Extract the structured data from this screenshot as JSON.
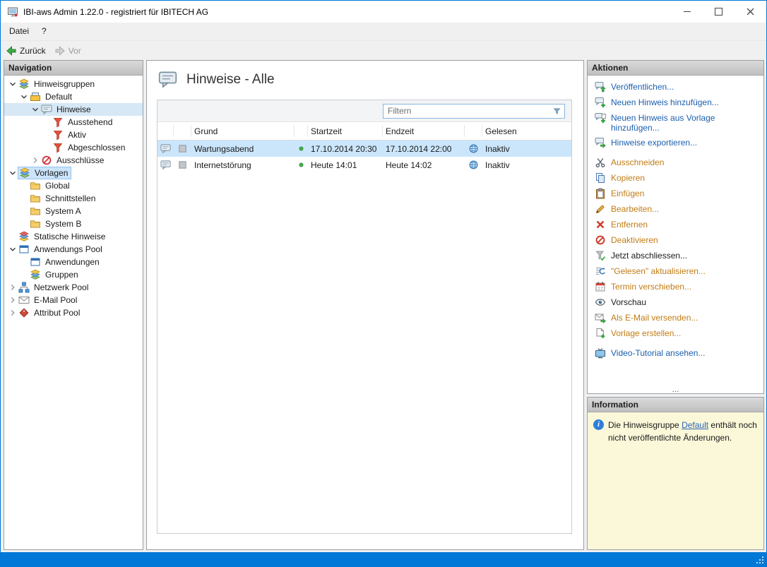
{
  "palette": {
    "accent_blue": "#0078D7",
    "link_blue": "#1B5FAE",
    "link_amber": "#C17C15",
    "text_dark": "#1B1B1B",
    "selection_blue": "#CBE6FB",
    "info_yellow": "#FBF8D9",
    "status_green": "#43B049",
    "alert_red": "#D13438"
  },
  "window": {
    "title": "IBI-aws Admin 1.22.0 - registriert für IBITECH AG"
  },
  "menu": {
    "items": [
      {
        "label": "Datei"
      },
      {
        "label": "?"
      }
    ]
  },
  "toolbar": {
    "back": "Zurück",
    "forward": "Vor"
  },
  "navigation": {
    "header": "Navigation",
    "items": [
      {
        "label": "Hinweisgruppen",
        "level": 0,
        "state": "expanded",
        "icon": "layers"
      },
      {
        "label": "Default",
        "level": 1,
        "state": "expanded",
        "icon": "group-box"
      },
      {
        "label": "Hinweise",
        "level": 2,
        "state": "expanded",
        "icon": "speech-bubble",
        "selected": true
      },
      {
        "label": "Ausstehend",
        "level": 3,
        "state": "leaf",
        "icon": "funnel"
      },
      {
        "label": "Aktiv",
        "level": 3,
        "state": "leaf",
        "icon": "funnel"
      },
      {
        "label": "Abgeschlossen",
        "level": 3,
        "state": "leaf",
        "icon": "funnel"
      },
      {
        "label": "Ausschlüsse",
        "level": 2,
        "state": "collapsed",
        "icon": "no-entry"
      },
      {
        "label": "Vorlagen",
        "level": 0,
        "state": "expanded",
        "icon": "layers",
        "highlighted": true
      },
      {
        "label": "Global",
        "level": 1,
        "state": "leaf",
        "icon": "folder"
      },
      {
        "label": "Schnittstellen",
        "level": 1,
        "state": "leaf",
        "icon": "folder"
      },
      {
        "label": "System A",
        "level": 1,
        "state": "leaf",
        "icon": "folder"
      },
      {
        "label": "System B",
        "level": 1,
        "state": "leaf",
        "icon": "folder"
      },
      {
        "label": "Statische Hinweise",
        "level": 0,
        "state": "leaf",
        "icon": "layers-static"
      },
      {
        "label": "Anwendungs Pool",
        "level": 0,
        "state": "expanded",
        "icon": "app-window"
      },
      {
        "label": "Anwendungen",
        "level": 1,
        "state": "leaf",
        "icon": "app-window"
      },
      {
        "label": "Gruppen",
        "level": 1,
        "state": "leaf",
        "icon": "layers"
      },
      {
        "label": "Netzwerk Pool",
        "level": 0,
        "state": "collapsed",
        "icon": "network"
      },
      {
        "label": "E-Mail Pool",
        "level": 0,
        "state": "collapsed",
        "icon": "envelope"
      },
      {
        "label": "Attribut Pool",
        "level": 0,
        "state": "collapsed",
        "icon": "tag"
      }
    ]
  },
  "main": {
    "title": "Hinweise - Alle",
    "filter": {
      "placeholder": "Filtern"
    },
    "table": {
      "headers": {
        "grund": "Grund",
        "startzeit": "Startzeit",
        "endzeit": "Endzeit",
        "gelesen": "Gelesen"
      },
      "rows": [
        {
          "grund": "Wartungsabend",
          "status": "green",
          "startzeit": "17.10.2014 20:30",
          "endzeit": "17.10.2014 22:00",
          "gelesen": "Inaktiv",
          "selected": true
        },
        {
          "grund": "Internetstörung",
          "status": "green",
          "startzeit": "Heute 14:01",
          "endzeit": "Heute 14:02",
          "gelesen": "Inaktiv",
          "selected": false
        }
      ]
    }
  },
  "actions": {
    "header": "Aktionen",
    "items": [
      {
        "label": "Veröffentlichen...",
        "color": "blue",
        "icon": "publish"
      },
      {
        "label": "Neuen Hinweis hinzufügen...",
        "color": "blue",
        "icon": "bubble-plus"
      },
      {
        "label": "Neuen Hinweis aus Vorlage hinzufügen...",
        "color": "blue",
        "icon": "bubble-template"
      },
      {
        "label": "Hinweise exportieren...",
        "color": "blue",
        "icon": "bubble-export"
      },
      {
        "label": "Ausschneiden",
        "color": "amber",
        "icon": "scissors"
      },
      {
        "label": "Kopieren",
        "color": "amber",
        "icon": "copy"
      },
      {
        "label": "Einfügen",
        "color": "amber",
        "icon": "clipboard"
      },
      {
        "label": "Bearbeiten...",
        "color": "amber",
        "icon": "pencil"
      },
      {
        "label": "Entfernen",
        "color": "amber",
        "icon": "delete-x"
      },
      {
        "label": "Deaktivieren",
        "color": "amber",
        "icon": "no-circle"
      },
      {
        "label": "Jetzt abschliessen...",
        "color": "dark",
        "icon": "finish-funnel"
      },
      {
        "label": "\"Gelesen\" aktualisieren...",
        "color": "amber",
        "icon": "refresh"
      },
      {
        "label": "Termin verschieben...",
        "color": "amber",
        "icon": "calendar"
      },
      {
        "label": "Vorschau",
        "color": "dark",
        "icon": "eye"
      },
      {
        "label": "Als E-Mail versenden...",
        "color": "amber",
        "icon": "mail-send"
      },
      {
        "label": "Vorlage erstellen...",
        "color": "amber",
        "icon": "page-plus"
      },
      {
        "label": "Video-Tutorial ansehen...",
        "color": "blue",
        "icon": "tv"
      }
    ],
    "more": "..."
  },
  "information": {
    "header": "Information",
    "text_before": "Die Hinweisgruppe ",
    "link": "Default",
    "text_after": " enthält noch nicht veröffentlichte Änderungen."
  }
}
